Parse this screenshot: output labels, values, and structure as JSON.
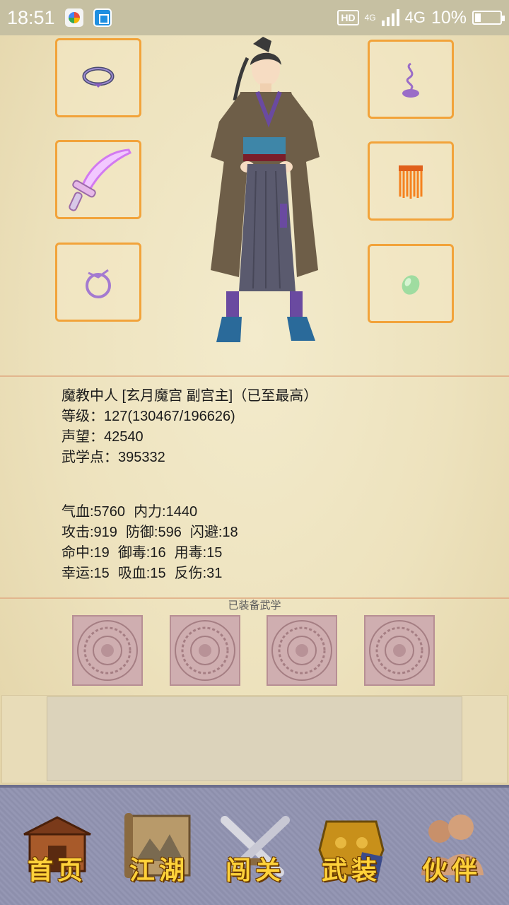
{
  "status_bar": {
    "time": "18:51",
    "hd_label": "HD",
    "network_small": "4G",
    "network": "4G",
    "battery": "10%"
  },
  "equipment": {
    "slots": [
      {
        "icon": "necklace-icon"
      },
      {
        "icon": "incense-icon"
      },
      {
        "icon": "sword-icon"
      },
      {
        "icon": "armor-tassel-icon"
      },
      {
        "icon": "ring-icon"
      },
      {
        "icon": "jade-gem-icon"
      }
    ]
  },
  "character": {
    "title": "魔教中人 [玄月魔宫 副宫主]（已至最高）",
    "level": "等级：127(130467/196626)",
    "reputation": "声望：42540",
    "martial_points": "武学点：395332"
  },
  "attributes": {
    "hp": "气血:5760",
    "mp": "内力:1440",
    "attack": "攻击:919",
    "defense": "防御:596",
    "dodge": "闪避:18",
    "hit": "命中:19",
    "poison_resist": "御毒:16",
    "poison_use": "用毒:15",
    "luck": "幸运:15",
    "lifesteal": "吸血:15",
    "reflect": "反伤:31"
  },
  "equipped_skills": {
    "title": "已装备武学",
    "slots": [
      "empty",
      "empty",
      "empty",
      "empty"
    ]
  },
  "nav": [
    {
      "label": "首页",
      "icon": "house-icon"
    },
    {
      "label": "江湖",
      "icon": "scroll-icon"
    },
    {
      "label": "闯关",
      "icon": "crossed-swords-icon"
    },
    {
      "label": "武装",
      "icon": "armor-icon"
    },
    {
      "label": "伙伴",
      "icon": "companions-icon"
    }
  ],
  "colors": {
    "slot_border": "#f2a33a",
    "parchment": "#ede2bd",
    "nav_bg": "#8d8fac",
    "nav_label": "#ffd23a"
  }
}
